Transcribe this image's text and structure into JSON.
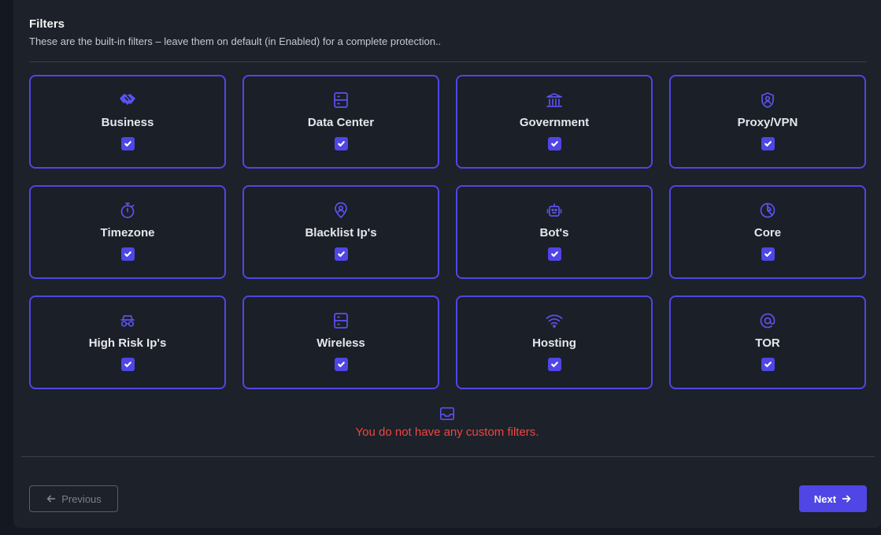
{
  "header": {
    "title": "Filters",
    "subtitle": "These are the built-in filters – leave them on default (in Enabled) for a complete protection.."
  },
  "filters": [
    {
      "label": "Business",
      "icon": "handshake-icon",
      "enabled": true
    },
    {
      "label": "Data Center",
      "icon": "server-icon",
      "enabled": true
    },
    {
      "label": "Government",
      "icon": "building-columns-icon",
      "enabled": true
    },
    {
      "label": "Proxy/VPN",
      "icon": "shield-user-icon",
      "enabled": true
    },
    {
      "label": "Timezone",
      "icon": "stopwatch-icon",
      "enabled": true
    },
    {
      "label": "Blacklist Ip's",
      "icon": "location-user-icon",
      "enabled": true
    },
    {
      "label": "Bot's",
      "icon": "robot-icon",
      "enabled": true
    },
    {
      "label": "Core",
      "icon": "pie-chart-icon",
      "enabled": true
    },
    {
      "label": "High Risk Ip's",
      "icon": "incognito-icon",
      "enabled": true
    },
    {
      "label": "Wireless",
      "icon": "server-icon",
      "enabled": true
    },
    {
      "label": "Hosting",
      "icon": "wifi-icon",
      "enabled": true
    },
    {
      "label": "TOR",
      "icon": "at-sign-icon",
      "enabled": true
    }
  ],
  "custom_filters": {
    "empty_icon": "inbox-icon",
    "empty_message": "You do not have any custom filters."
  },
  "footer": {
    "previous_label": "Previous",
    "next_label": "Next"
  },
  "colors": {
    "accent": "#4f46e5",
    "error": "#f04545",
    "panel": "#1d2129"
  }
}
